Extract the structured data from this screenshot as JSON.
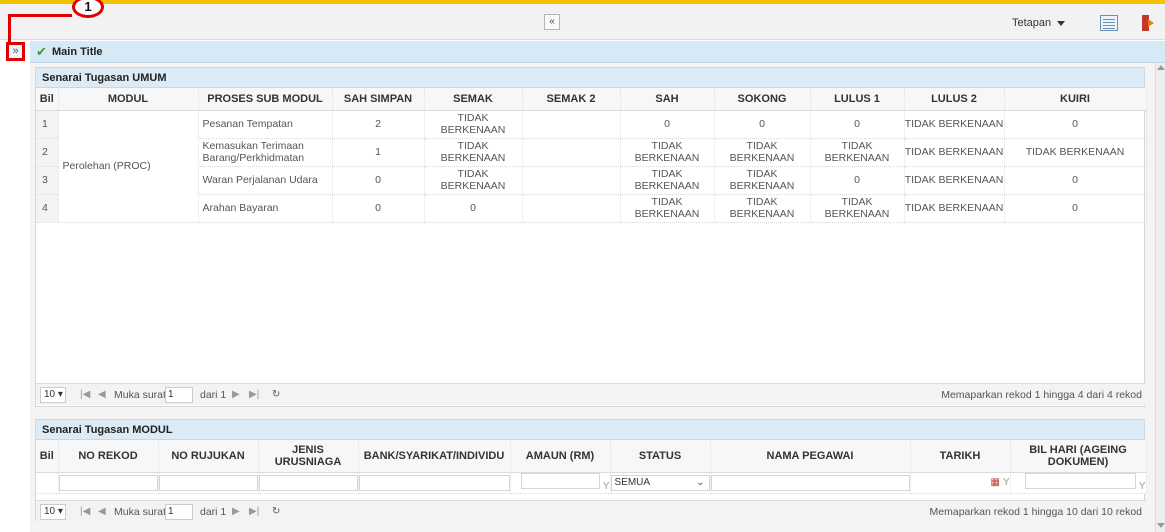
{
  "header": {
    "collapse_symbol": "«",
    "settings_label": "Tetapan",
    "callout_number": "1",
    "expand_symbol": "»",
    "title": "Main Title"
  },
  "panel1": {
    "title": "Senarai Tugasan UMUM",
    "columns": [
      "Bil",
      "MODUL",
      "PROSES SUB MODUL",
      "SAH SIMPAN",
      "SEMAK",
      "SEMAK 2",
      "SAH",
      "SOKONG",
      "LULUS 1",
      "LULUS 2",
      "KUIRI"
    ],
    "modul": "Perolehan (PROC)",
    "rows": [
      {
        "bil": "1",
        "proses": "Pesanan Tempatan",
        "sah_simpan": "2",
        "semak": "TIDAK BERKENAAN",
        "semak2": "",
        "sah": "0",
        "sokong": "0",
        "lulus1": "0",
        "lulus2": "TIDAK BERKENAAN",
        "kuiri": "0"
      },
      {
        "bil": "2",
        "proses": "Kemasukan Terimaan Barang/Perkhidmatan",
        "sah_simpan": "1",
        "semak": "TIDAK BERKENAAN",
        "semak2": "",
        "sah": "TIDAK BERKENAAN",
        "sokong": "TIDAK BERKENAAN",
        "lulus1": "TIDAK BERKENAAN",
        "lulus2": "TIDAK BERKENAAN",
        "kuiri": "TIDAK BERKENAAN"
      },
      {
        "bil": "3",
        "proses": "Waran Perjalanan Udara",
        "sah_simpan": "0",
        "semak": "TIDAK BERKENAAN",
        "semak2": "",
        "sah": "TIDAK BERKENAAN",
        "sokong": "TIDAK BERKENAAN",
        "lulus1": "0",
        "lulus2": "TIDAK BERKENAAN",
        "kuiri": "0"
      },
      {
        "bil": "4",
        "proses": "Arahan Bayaran",
        "sah_simpan": "0",
        "semak": "0",
        "semak2": "",
        "sah": "TIDAK BERKENAAN",
        "sokong": "TIDAK BERKENAAN",
        "lulus1": "TIDAK BERKENAAN",
        "lulus2": "TIDAK BERKENAAN",
        "kuiri": "0"
      }
    ],
    "pager": {
      "page_size": "10 ▾",
      "first": "|◀",
      "prev": "◀",
      "page_label": "Muka surat",
      "page_value": "1",
      "of_label": "dari 1",
      "next": "▶",
      "last": "▶|",
      "refresh": "↻",
      "info": "Memaparkan rekod 1 hingga 4 dari 4 rekod"
    }
  },
  "panel2": {
    "title": "Senarai Tugasan MODUL",
    "columns": [
      "Bil",
      "NO REKOD",
      "NO RUJUKAN",
      "JENIS URUSNIAGA",
      "BANK/SYARIKAT/INDIVIDU",
      "AMAUN (RM)",
      "STATUS",
      "NAMA PEGAWAI",
      "TARIKH",
      "BIL HARI (AGEING DOKUMEN)"
    ],
    "status_filter_value": "SEMUA",
    "pager": {
      "page_size": "10 ▾",
      "first": "|◀",
      "prev": "◀",
      "page_label": "Muka surat",
      "page_value": "1",
      "of_label": "dari 1",
      "next": "▶",
      "last": "▶|",
      "refresh": "↻",
      "info": "Memaparkan rekod 1 hingga 10 dari 10 rekod"
    }
  },
  "icons": {
    "collapse": "chevron-up-double-icon",
    "expand": "chevron-right-double-icon",
    "check": "check-icon",
    "grid": "grid-view-icon",
    "exit": "logout-icon",
    "filter": "filter-icon",
    "calendar": "calendar-icon"
  },
  "colors": {
    "accent_yellow": "#f2c300",
    "callout_red": "#e00000",
    "title_bar": "#d6e9f5",
    "check_green": "#3c9b2d"
  }
}
